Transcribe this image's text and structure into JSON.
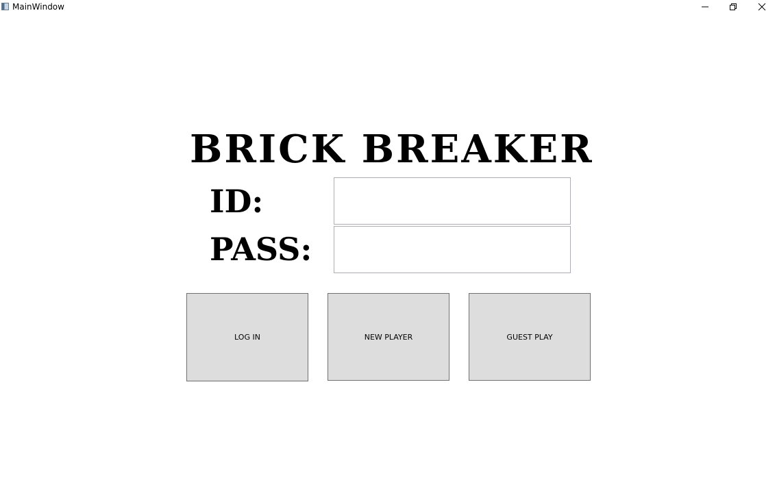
{
  "window": {
    "title": "MainWindow",
    "controls": {
      "minimize": "minimize-icon",
      "restore": "restore-icon",
      "close": "close-icon"
    }
  },
  "main": {
    "game_title": "BRICK BREAKER",
    "id_label": "ID:",
    "pass_label": "PASS:",
    "id_value": "",
    "pass_value": ""
  },
  "buttons": {
    "login": "LOG IN",
    "new_player": "NEW PLAYER",
    "guest_play": "GUEST PLAY"
  },
  "colors": {
    "button_bg": "#dddddd",
    "button_border": "#707070",
    "field_border": "#abadb3"
  }
}
